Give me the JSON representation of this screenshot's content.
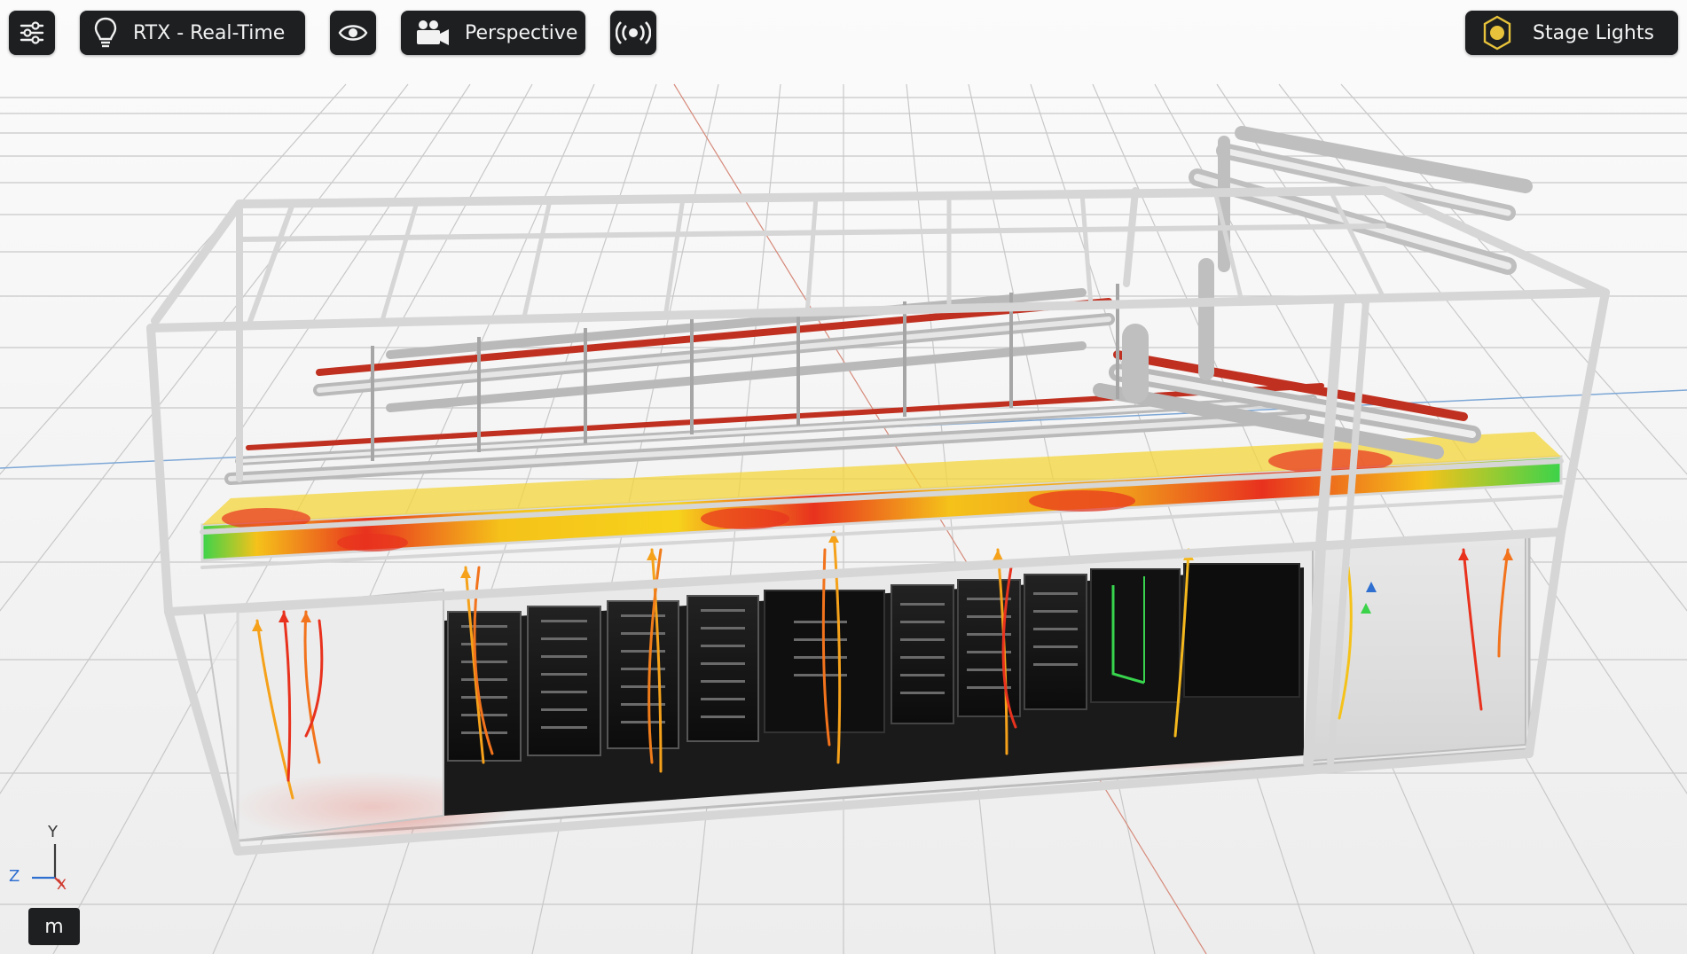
{
  "toolbar": {
    "settings_icon": "sliders-icon",
    "render_mode": {
      "icon": "lightbulb-icon",
      "label": "RTX - Real-Time"
    },
    "visibility_icon": "eye-icon",
    "camera": {
      "icon": "movie-camera-icon",
      "label": "Perspective"
    },
    "broadcast_icon": "broadcast-icon",
    "lighting": {
      "icon": "sun-icon",
      "label": "Stage Lights"
    }
  },
  "axes": {
    "y": "Y",
    "z": "Z",
    "x": "X"
  },
  "units": {
    "label": "m"
  },
  "colors": {
    "toolbar_bg": "#1d1f21",
    "toolbar_text": "#f2f2f2",
    "floor": "#f1f1f1",
    "grid": "#c8c8c8",
    "heat_hot": "#e8321e",
    "heat_warm": "#f5c21a",
    "heat_cool": "#3bd34a",
    "rack": "#141414",
    "frame": "#d9d9d9",
    "stage_lights_icon": "#e7c23a",
    "axis_y": "#3a3a3a",
    "axis_z": "#2f6fd0",
    "axis_x": "#d03a2f"
  }
}
